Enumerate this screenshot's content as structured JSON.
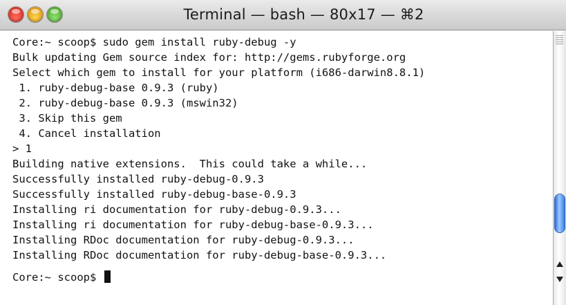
{
  "window": {
    "title": "Terminal — bash — 80x17 — ⌘2"
  },
  "terminal": {
    "lines": [
      "Core:~ scoop$ sudo gem install ruby-debug -y",
      "Bulk updating Gem source index for: http://gems.rubyforge.org",
      "Select which gem to install for your platform (i686-darwin8.8.1)",
      " 1. ruby-debug-base 0.9.3 (ruby)",
      " 2. ruby-debug-base 0.9.3 (mswin32)",
      " 3. Skip this gem",
      " 4. Cancel installation",
      "> 1",
      "Building native extensions.  This could take a while...",
      "Successfully installed ruby-debug-0.9.3",
      "Successfully installed ruby-debug-base-0.9.3",
      "Installing ri documentation for ruby-debug-0.9.3...",
      "Installing ri documentation for ruby-debug-base-0.9.3...",
      "Installing RDoc documentation for ruby-debug-0.9.3...",
      "Installing RDoc documentation for ruby-debug-base-0.9.3...",
      "Core:~ scoop$ "
    ]
  },
  "icons": {
    "close": "close-button-icon",
    "minimize": "minimize-button-icon",
    "zoom": "zoom-button-icon",
    "cursor": "text-cursor"
  }
}
